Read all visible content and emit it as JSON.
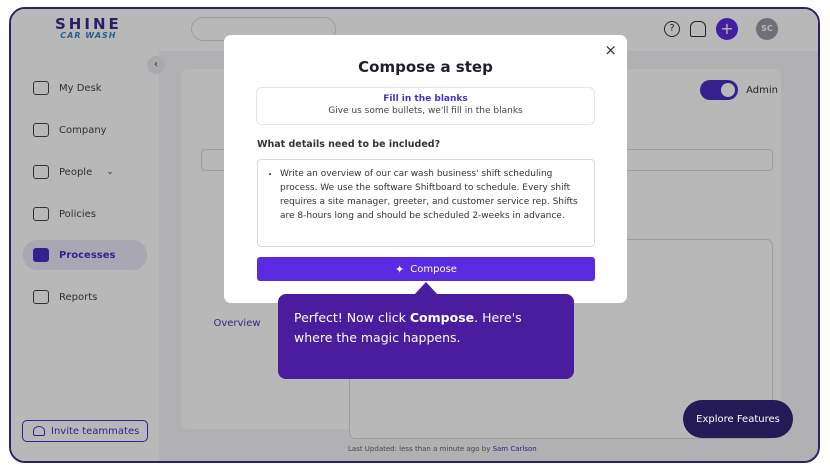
{
  "brand": {
    "line1": "SHINE",
    "line2": "CAR WASH"
  },
  "sidebar": {
    "collapse_icon": "chevron-left-icon",
    "items": [
      {
        "label": "My Desk",
        "icon": "monitor-icon"
      },
      {
        "label": "Company",
        "icon": "building-icon"
      },
      {
        "label": "People",
        "icon": "people-icon"
      },
      {
        "label": "Policies",
        "icon": "document-icon"
      },
      {
        "label": "Processes",
        "icon": "processes-icon"
      },
      {
        "label": "Reports",
        "icon": "report-icon"
      }
    ],
    "invite_label": "Invite teammates"
  },
  "topbar": {
    "avatar_initials": "SC"
  },
  "admin": {
    "label": "Admin",
    "enabled": true
  },
  "background": {
    "overview_tab": "Overview",
    "footer_prefix": "Last Updated: less than a minute ago by ",
    "footer_author": "Sam Carlson"
  },
  "modal": {
    "title": "Compose a step",
    "close_symbol": "×",
    "blank_card": {
      "title": "Fill in the blanks",
      "subtitle": "Give us some bullets, we'll fill in the blanks"
    },
    "details_label": "What details need to be included?",
    "details_text": "Write an overview of our car wash business' shift scheduling process. We use the software Shiftboard to schedule. Every shift requires a site manager, greeter, and customer service rep. Shifts are 8-hours long and should be scheduled 2-weeks in advance.",
    "compose_label": "Compose"
  },
  "tooltip": {
    "prefix": "Perfect! Now click ",
    "bold": "Compose",
    "suffix": ". Here's where the magic happens."
  },
  "explore_label": "Explore Features",
  "colors": {
    "accent": "#5a2be0",
    "tooltip_bg": "#4a1d9e",
    "explore_bg": "#241a55"
  }
}
